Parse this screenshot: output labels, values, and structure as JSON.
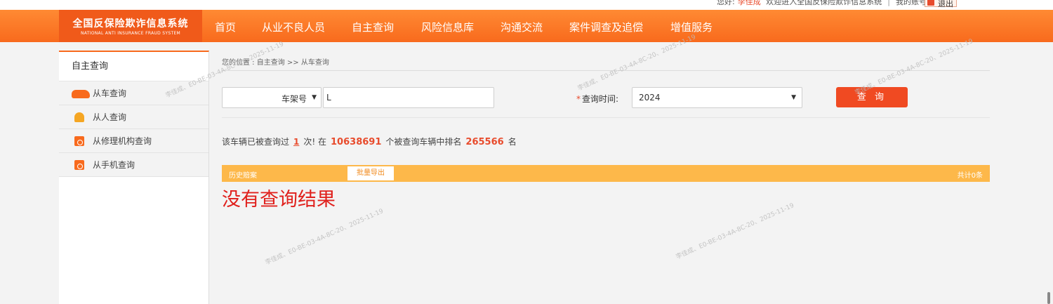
{
  "topbar": {
    "greeting_prefix": "您好:",
    "username": "李佳成",
    "welcome": "欢迎进入全国反保险欺诈信息系统",
    "separator": "|",
    "my_account": "我的账号",
    "logout": "退出"
  },
  "logo": {
    "cn": "全国反保险欺诈信息系统",
    "en": "NATIONAL ANTI INSURANCE FRAUD SYSTEM"
  },
  "nav": {
    "items": [
      "首页",
      "从业不良人员",
      "自主查询",
      "风险信息库",
      "沟通交流",
      "案件调查及追偿",
      "增值服务"
    ]
  },
  "sidebar": {
    "title": "自主查询",
    "items": [
      {
        "label": "从车查询",
        "icon": "car-icon"
      },
      {
        "label": "从人查询",
        "icon": "person-icon"
      },
      {
        "label": "从修理机构查询",
        "icon": "repair-shop-icon"
      },
      {
        "label": "从手机查询",
        "icon": "phone-icon"
      }
    ]
  },
  "breadcrumb": "您的位置 : 自主查询 >> 从车查询",
  "form": {
    "type_select_value": "车架号",
    "vin_value": "L",
    "required_mark": "*",
    "time_label": "查询时间:",
    "year_value": "2024",
    "query_button": "查 询"
  },
  "stats": {
    "part1": "该车辆已被查询过",
    "times": "1",
    "part2": "次! 在",
    "total": "10638691",
    "part3": "个被查询车辆中排名",
    "rank": "265566",
    "part4": "名"
  },
  "history": {
    "title": "历史赔案",
    "export_button": "批量导出",
    "total": "共计0条"
  },
  "no_result": "没有查询结果",
  "watermark": "李佳成、E0-BE-03-4A-8C-20、2025-11-19",
  "colors": {
    "nav_orange": "#f86a1d",
    "accent_red": "#e84b2c",
    "history_bar": "#fdb84a",
    "no_result_red": "#e0201c"
  }
}
